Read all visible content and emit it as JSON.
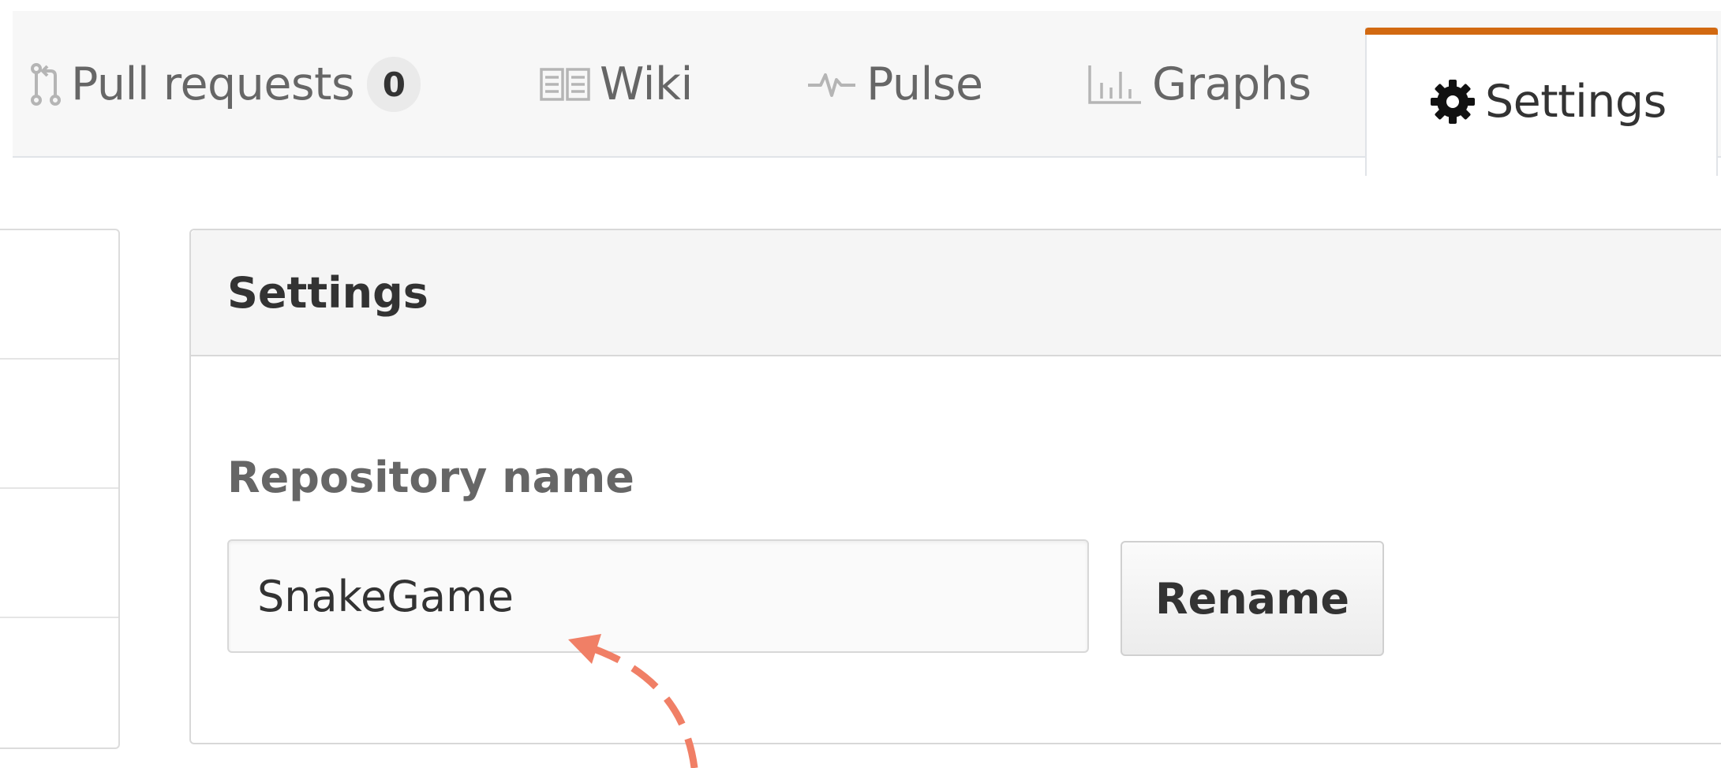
{
  "tabs": {
    "pulls": {
      "label": "Pull requests",
      "count": "0",
      "icon": "git-pull-request-icon"
    },
    "wiki": {
      "label": "Wiki",
      "icon": "book-icon"
    },
    "pulse": {
      "label": "Pulse",
      "icon": "pulse-icon"
    },
    "graphs": {
      "label": "Graphs",
      "icon": "graph-icon"
    },
    "settings": {
      "label": "Settings",
      "icon": "gear-icon",
      "selected": true
    }
  },
  "settings_box": {
    "title": "Settings",
    "repo_name_label": "Repository name",
    "repo_name_value": "SnakeGame",
    "rename_button": "Rename"
  },
  "colors": {
    "selected_tab_accent": "#d26911",
    "annotation_arrow": "#f07f66"
  },
  "annotation": {
    "icon": "dashed-arrow-icon"
  }
}
